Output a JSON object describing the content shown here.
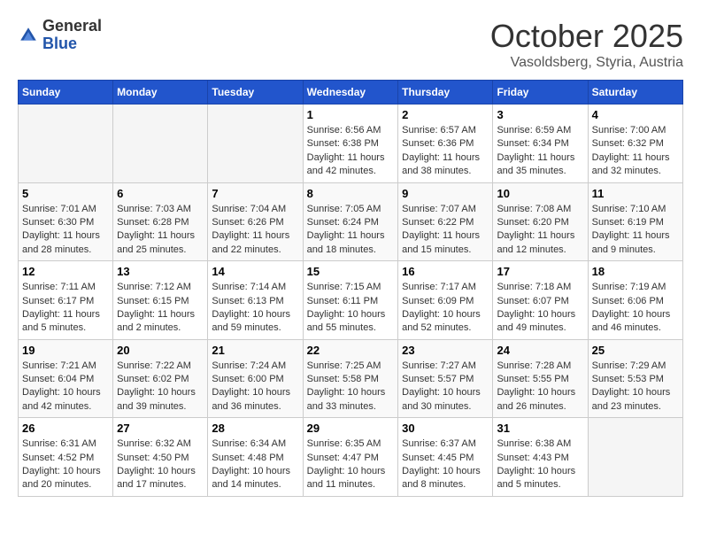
{
  "header": {
    "logo_general": "General",
    "logo_blue": "Blue",
    "month_title": "October 2025",
    "subtitle": "Vasoldsberg, Styria, Austria"
  },
  "days_of_week": [
    "Sunday",
    "Monday",
    "Tuesday",
    "Wednesday",
    "Thursday",
    "Friday",
    "Saturday"
  ],
  "weeks": [
    [
      {
        "day": "",
        "info": ""
      },
      {
        "day": "",
        "info": ""
      },
      {
        "day": "",
        "info": ""
      },
      {
        "day": "1",
        "info": "Sunrise: 6:56 AM\nSunset: 6:38 PM\nDaylight: 11 hours and 42 minutes."
      },
      {
        "day": "2",
        "info": "Sunrise: 6:57 AM\nSunset: 6:36 PM\nDaylight: 11 hours and 38 minutes."
      },
      {
        "day": "3",
        "info": "Sunrise: 6:59 AM\nSunset: 6:34 PM\nDaylight: 11 hours and 35 minutes."
      },
      {
        "day": "4",
        "info": "Sunrise: 7:00 AM\nSunset: 6:32 PM\nDaylight: 11 hours and 32 minutes."
      }
    ],
    [
      {
        "day": "5",
        "info": "Sunrise: 7:01 AM\nSunset: 6:30 PM\nDaylight: 11 hours and 28 minutes."
      },
      {
        "day": "6",
        "info": "Sunrise: 7:03 AM\nSunset: 6:28 PM\nDaylight: 11 hours and 25 minutes."
      },
      {
        "day": "7",
        "info": "Sunrise: 7:04 AM\nSunset: 6:26 PM\nDaylight: 11 hours and 22 minutes."
      },
      {
        "day": "8",
        "info": "Sunrise: 7:05 AM\nSunset: 6:24 PM\nDaylight: 11 hours and 18 minutes."
      },
      {
        "day": "9",
        "info": "Sunrise: 7:07 AM\nSunset: 6:22 PM\nDaylight: 11 hours and 15 minutes."
      },
      {
        "day": "10",
        "info": "Sunrise: 7:08 AM\nSunset: 6:20 PM\nDaylight: 11 hours and 12 minutes."
      },
      {
        "day": "11",
        "info": "Sunrise: 7:10 AM\nSunset: 6:19 PM\nDaylight: 11 hours and 9 minutes."
      }
    ],
    [
      {
        "day": "12",
        "info": "Sunrise: 7:11 AM\nSunset: 6:17 PM\nDaylight: 11 hours and 5 minutes."
      },
      {
        "day": "13",
        "info": "Sunrise: 7:12 AM\nSunset: 6:15 PM\nDaylight: 11 hours and 2 minutes."
      },
      {
        "day": "14",
        "info": "Sunrise: 7:14 AM\nSunset: 6:13 PM\nDaylight: 10 hours and 59 minutes."
      },
      {
        "day": "15",
        "info": "Sunrise: 7:15 AM\nSunset: 6:11 PM\nDaylight: 10 hours and 55 minutes."
      },
      {
        "day": "16",
        "info": "Sunrise: 7:17 AM\nSunset: 6:09 PM\nDaylight: 10 hours and 52 minutes."
      },
      {
        "day": "17",
        "info": "Sunrise: 7:18 AM\nSunset: 6:07 PM\nDaylight: 10 hours and 49 minutes."
      },
      {
        "day": "18",
        "info": "Sunrise: 7:19 AM\nSunset: 6:06 PM\nDaylight: 10 hours and 46 minutes."
      }
    ],
    [
      {
        "day": "19",
        "info": "Sunrise: 7:21 AM\nSunset: 6:04 PM\nDaylight: 10 hours and 42 minutes."
      },
      {
        "day": "20",
        "info": "Sunrise: 7:22 AM\nSunset: 6:02 PM\nDaylight: 10 hours and 39 minutes."
      },
      {
        "day": "21",
        "info": "Sunrise: 7:24 AM\nSunset: 6:00 PM\nDaylight: 10 hours and 36 minutes."
      },
      {
        "day": "22",
        "info": "Sunrise: 7:25 AM\nSunset: 5:58 PM\nDaylight: 10 hours and 33 minutes."
      },
      {
        "day": "23",
        "info": "Sunrise: 7:27 AM\nSunset: 5:57 PM\nDaylight: 10 hours and 30 minutes."
      },
      {
        "day": "24",
        "info": "Sunrise: 7:28 AM\nSunset: 5:55 PM\nDaylight: 10 hours and 26 minutes."
      },
      {
        "day": "25",
        "info": "Sunrise: 7:29 AM\nSunset: 5:53 PM\nDaylight: 10 hours and 23 minutes."
      }
    ],
    [
      {
        "day": "26",
        "info": "Sunrise: 6:31 AM\nSunset: 4:52 PM\nDaylight: 10 hours and 20 minutes."
      },
      {
        "day": "27",
        "info": "Sunrise: 6:32 AM\nSunset: 4:50 PM\nDaylight: 10 hours and 17 minutes."
      },
      {
        "day": "28",
        "info": "Sunrise: 6:34 AM\nSunset: 4:48 PM\nDaylight: 10 hours and 14 minutes."
      },
      {
        "day": "29",
        "info": "Sunrise: 6:35 AM\nSunset: 4:47 PM\nDaylight: 10 hours and 11 minutes."
      },
      {
        "day": "30",
        "info": "Sunrise: 6:37 AM\nSunset: 4:45 PM\nDaylight: 10 hours and 8 minutes."
      },
      {
        "day": "31",
        "info": "Sunrise: 6:38 AM\nSunset: 4:43 PM\nDaylight: 10 hours and 5 minutes."
      },
      {
        "day": "",
        "info": ""
      }
    ]
  ]
}
